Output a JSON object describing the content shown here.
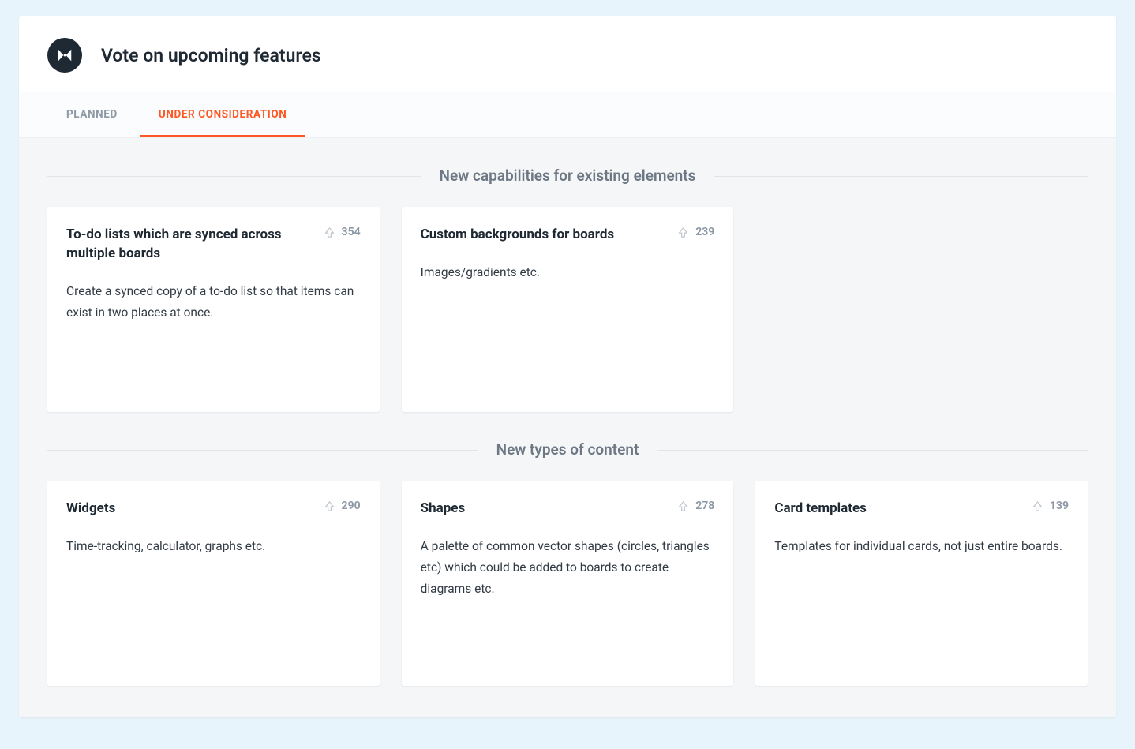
{
  "header": {
    "title": "Vote on upcoming features"
  },
  "tabs": [
    {
      "label": "PLANNED",
      "active": false
    },
    {
      "label": "UNDER CONSIDERATION",
      "active": true
    }
  ],
  "sections": [
    {
      "title": "New capabilities for existing elements",
      "cards": [
        {
          "title": "To-do lists which are synced across multiple boards",
          "votes": "354",
          "body": "Create a synced copy of a to-do list so that items can exist in two places at once."
        },
        {
          "title": "Custom backgrounds for boards",
          "votes": "239",
          "body": "Images/gradients etc."
        }
      ]
    },
    {
      "title": "New types of content",
      "cards": [
        {
          "title": "Widgets",
          "votes": "290",
          "body": "Time-tracking, calculator, graphs etc."
        },
        {
          "title": "Shapes",
          "votes": "278",
          "body": "A palette of common vector shapes (circles, triangles etc) which could be added to boards to create diagrams etc."
        },
        {
          "title": "Card templates",
          "votes": "139",
          "body": "Templates for individual cards, not just entire boards."
        }
      ]
    }
  ]
}
